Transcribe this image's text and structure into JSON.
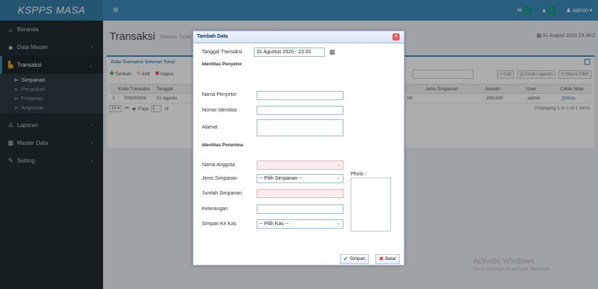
{
  "app": {
    "logo": "KSPPS MASA"
  },
  "sidebar": {
    "items": [
      {
        "label": "Beranda"
      },
      {
        "label": "Data Master"
      },
      {
        "label": "Transaksi"
      },
      {
        "label": "Laporan"
      },
      {
        "label": "Master Data"
      },
      {
        "label": "Setting"
      }
    ],
    "sub_items": [
      "Simpanan",
      "Penarikan",
      "Pinjaman",
      "Angsuran"
    ]
  },
  "topbar": {
    "user": "admin"
  },
  "page": {
    "title": "Transaksi",
    "subtitle": "Setoran Tunai",
    "datetime": "31 August 2020  23:34:2"
  },
  "box": {
    "title": "Data Transaksi Setoran Tunai",
    "toolbar": [
      "Tambah",
      "Edit",
      "Hapus"
    ],
    "right_tools": [
      "Cari",
      "Cetak Laporan",
      "Hapus Filter"
    ],
    "columns": [
      "Kode Transaksi",
      "Tanggal",
      "Jenis Simpanan",
      "Jumlah",
      "User",
      "Cetak Nota"
    ],
    "row": [
      "1",
      "TRD00004",
      "21 Agustu",
      "SK",
      "200,000",
      "admin",
      "Nota"
    ],
    "pager": {
      "size": "10",
      "page_label": "Page",
      "page": "1",
      "of": "of"
    },
    "displaying": "Displaying 1 to 1 of 1 items"
  },
  "watermark": {
    "line1": "Activate Windows",
    "line2": "Go to Settings to activate Windows."
  },
  "modal": {
    "title": "Tambah Data",
    "tanggal_label": "Tanggal Transaksi",
    "tanggal_value": "31 Agustus 2020 - 23:33",
    "section_penyetor": "Identitas Penyetor",
    "nama_penyetor": "Nama Penyetor",
    "nomor_identitas": "Nomor Identitas",
    "alamat": "Alamat",
    "section_penerima": "Identitas Penerima",
    "nama_anggota": "Nama Anggota",
    "jenis_simpanan": "Jenis Simpanan",
    "jenis_simpanan_value": "-- Pilih Simpanan --",
    "jumlah_simpanan": "Jumlah Simpanan",
    "keterangan": "Keterangan",
    "simpan_ke_kas": "Simpan Ke Kas",
    "simpan_ke_kas_value": "-- Pilih Kas --",
    "photo": "Photo :",
    "btn_simpan": "Simpan",
    "btn_batal": "Batal"
  },
  "colors": {
    "primary": "#3c8dbc",
    "sidebar": "#222d32",
    "success": "#00a65a"
  }
}
